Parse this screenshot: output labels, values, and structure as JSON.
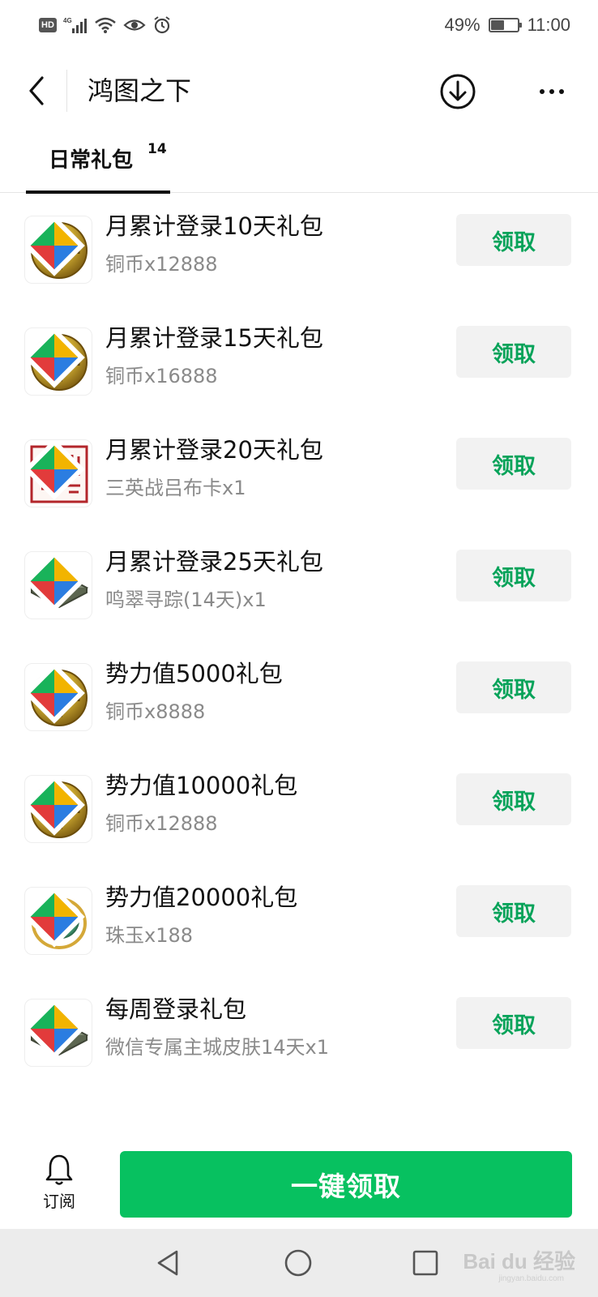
{
  "status_bar": {
    "hd": "HD",
    "network": "4G",
    "battery_percent": "49%",
    "battery_level": 0.49,
    "time": "11:00"
  },
  "nav": {
    "title": "鸿图之下",
    "back_icon": "chevron-left-icon",
    "download_icon": "download-circle-icon",
    "more_icon": "more-dots-icon"
  },
  "tabs": [
    {
      "label": "日常礼包",
      "count": "14",
      "active": true
    }
  ],
  "gifts": [
    {
      "title": "月累计登录10天礼包",
      "reward": "铜币x12888",
      "icon": "coin-icon",
      "button": "领取"
    },
    {
      "title": "月累计登录15天礼包",
      "reward": "铜币x16888",
      "icon": "coin-icon",
      "button": "领取"
    },
    {
      "title": "月累计登录20天礼包",
      "reward": "三英战吕布卡x1",
      "icon": "seal-card-icon",
      "button": "领取"
    },
    {
      "title": "月累计登录25天礼包",
      "reward": "鸣翠寻踪(14天)x1",
      "icon": "city-skin-icon",
      "button": "领取"
    },
    {
      "title": "势力值5000礼包",
      "reward": "铜币x8888",
      "icon": "coin-icon",
      "button": "领取"
    },
    {
      "title": "势力值10000礼包",
      "reward": "铜币x12888",
      "icon": "coin-icon",
      "button": "领取"
    },
    {
      "title": "势力值20000礼包",
      "reward": "珠玉x188",
      "icon": "jade-icon",
      "button": "领取"
    },
    {
      "title": "每周登录礼包",
      "reward": "微信专属主城皮肤14天x1",
      "icon": "city-skin-icon",
      "button": "领取"
    }
  ],
  "bottom": {
    "subscribe_label": "订阅",
    "claim_all_label": "一键领取"
  },
  "colors": {
    "accent_green": "#07c160",
    "button_text_green": "#07a35a",
    "button_bg": "#f2f2f2"
  },
  "watermark": {
    "brand": "Bai du 经验",
    "url": "jingyan.baidu.com"
  }
}
